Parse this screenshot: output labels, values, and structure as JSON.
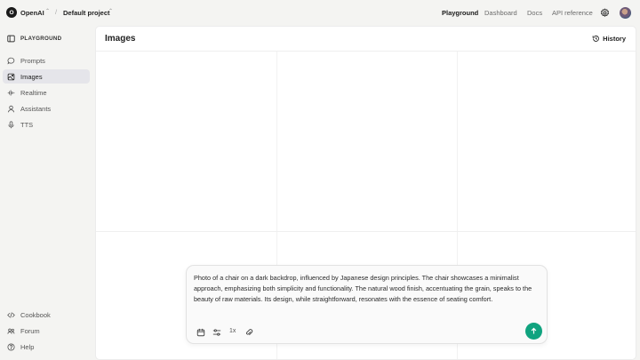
{
  "header": {
    "org_initial": "O",
    "org_name": "OpenAI",
    "separator": "/",
    "project_name": "Default project",
    "nav": [
      {
        "label": "Playground",
        "active": true
      },
      {
        "label": "Dashboard",
        "active": false
      },
      {
        "label": "Docs",
        "active": false
      },
      {
        "label": "API reference",
        "active": false
      }
    ],
    "settings_icon": "gear-icon",
    "avatar": "user-avatar"
  },
  "sidebar": {
    "section_label": "PLAYGROUND",
    "items": [
      {
        "label": "Prompts",
        "icon": "chat-bubble-icon",
        "active": false
      },
      {
        "label": "Images",
        "icon": "image-icon",
        "active": true
      },
      {
        "label": "Realtime",
        "icon": "waveform-icon",
        "active": false
      },
      {
        "label": "Assistants",
        "icon": "person-icon",
        "active": false
      },
      {
        "label": "TTS",
        "icon": "microphone-icon",
        "active": false
      }
    ],
    "footer_items": [
      {
        "label": "Cookbook",
        "icon": "code-icon"
      },
      {
        "label": "Forum",
        "icon": "forum-icon"
      },
      {
        "label": "Help",
        "icon": "help-icon"
      }
    ]
  },
  "main": {
    "title": "Images",
    "history_label": "History"
  },
  "composer": {
    "prompt": "Photo of a chair on a dark backdrop, influenced by Japanese design principles. The chair showcases a minimalist approach, emphasizing both simplicity and functionality. The natural wood finish, accentuating the grain, speaks to the beauty of raw materials. Its design, while straightforward, resonates with the essence of seating comfort.",
    "image_count": "1x",
    "accent_color": "#10a37f"
  }
}
